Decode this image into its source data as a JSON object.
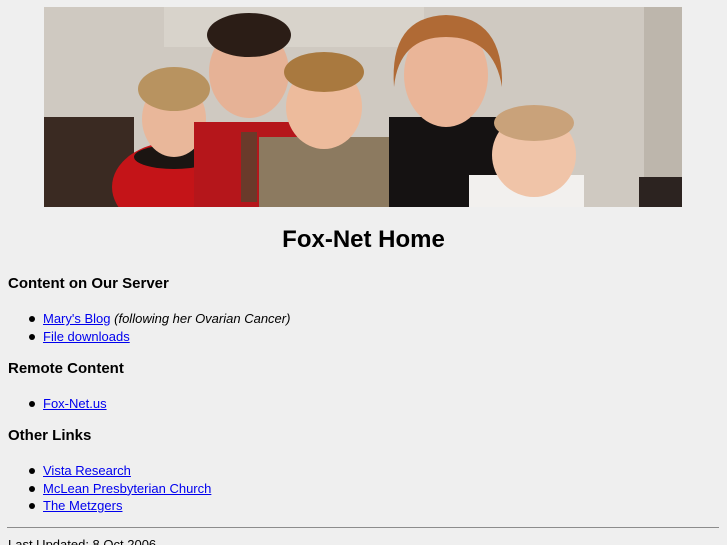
{
  "page_title": "Fox-Net Home",
  "sections": {
    "server": {
      "heading": "Content on Our Server",
      "items": [
        {
          "link": "Mary's Blog",
          "note": "(following her Ovarian Cancer)"
        },
        {
          "link": "File downloads"
        }
      ]
    },
    "remote": {
      "heading": "Remote Content",
      "items": [
        {
          "link": "Fox-Net.us"
        }
      ]
    },
    "other": {
      "heading": "Other Links",
      "items": [
        {
          "link": "Vista Research"
        },
        {
          "link": "McLean Presbyterian Church"
        },
        {
          "link": "The Metzgers"
        }
      ]
    }
  },
  "footer": {
    "last_updated": "Last Updated: 8 Oct 2006"
  },
  "colors": {
    "background": "#efefef",
    "link": "#0000ee"
  }
}
